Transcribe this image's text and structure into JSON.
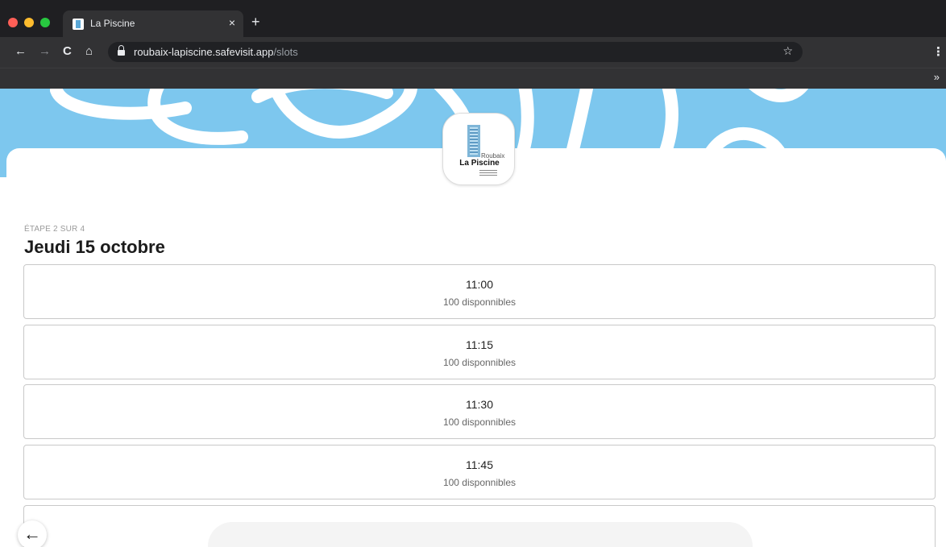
{
  "browser": {
    "tab_title": "La Piscine",
    "tab_close": "×",
    "new_tab": "+",
    "url_host": "roubaix-lapiscine.safevisit.app",
    "url_path": "/slots",
    "icons": {
      "back": "←",
      "forward": "→",
      "reload": "C",
      "home": "⌂",
      "star": "☆",
      "menu": "⋮",
      "bookmarks_more": "»"
    }
  },
  "logo": {
    "subtitle": "Roubaix",
    "name": "La Piscine"
  },
  "header": {
    "step": "ÉTAPE 2 SUR 4",
    "date": "Jeudi 15 octobre"
  },
  "slots": [
    {
      "time": "11:00",
      "availability": "100 disponnibles"
    },
    {
      "time": "11:15",
      "availability": "100 disponnibles"
    },
    {
      "time": "11:30",
      "availability": "100 disponnibles"
    },
    {
      "time": "11:45",
      "availability": "100 disponnibles"
    }
  ],
  "footer": {
    "back_icon": "←"
  },
  "colors": {
    "hero": "#7dc7ee",
    "chrome_dark": "#1f1f22",
    "chrome_toolbar": "#323234"
  }
}
